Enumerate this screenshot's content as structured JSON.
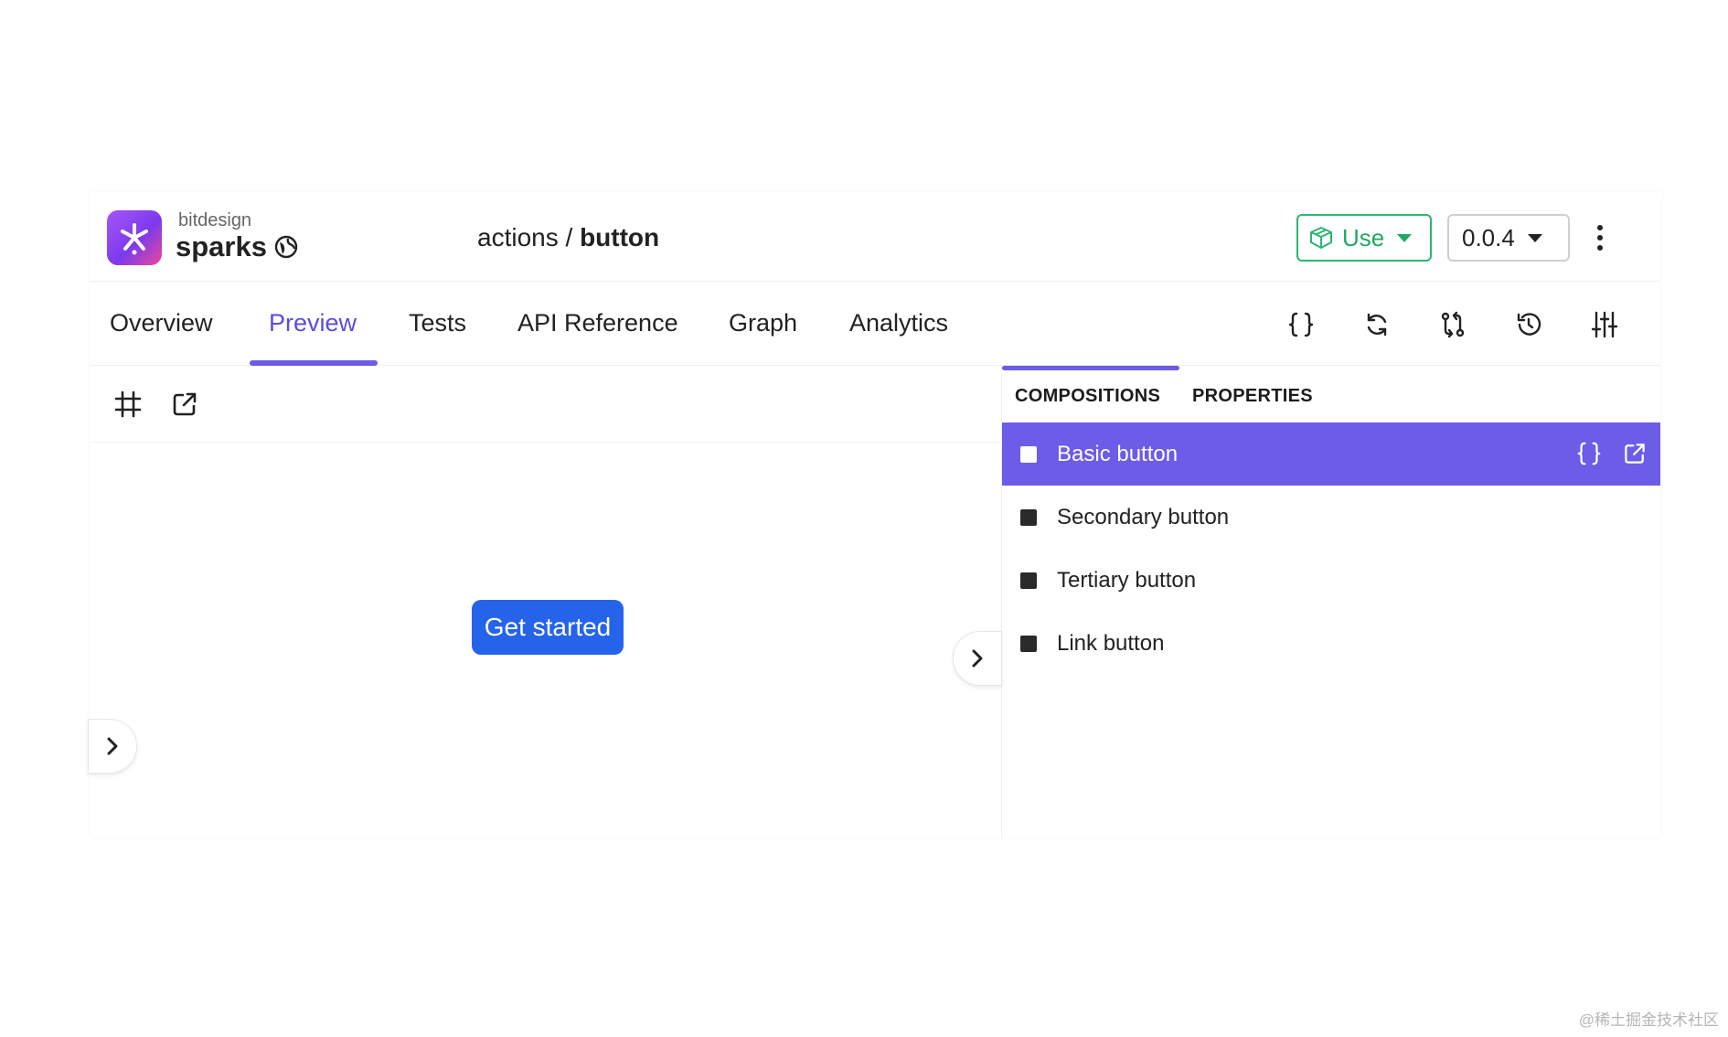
{
  "header": {
    "org": "bitdesign",
    "scope": "sparks",
    "breadcrumb_scope": "actions",
    "breadcrumb_sep": "/",
    "breadcrumb_name": "button",
    "use_label": "Use",
    "version": "0.0.4"
  },
  "tabs": [
    {
      "label": "Overview"
    },
    {
      "label": "Preview"
    },
    {
      "label": "Tests"
    },
    {
      "label": "API Reference"
    },
    {
      "label": "Graph"
    },
    {
      "label": "Analytics"
    }
  ],
  "active_tab": "Preview",
  "toolbar_icons": [
    "code-braces-icon",
    "refresh-icon",
    "compare-icon",
    "history-icon",
    "sliders-icon"
  ],
  "preview": {
    "button_label": "Get started"
  },
  "panel": {
    "tabs": [
      {
        "label": "COMPOSITIONS"
      },
      {
        "label": "PROPERTIES"
      }
    ],
    "items": [
      {
        "label": "Basic button"
      },
      {
        "label": "Secondary button"
      },
      {
        "label": "Tertiary button"
      },
      {
        "label": "Link button"
      }
    ],
    "active_item": "Basic button"
  },
  "colors": {
    "accent": "#6c5ce7",
    "use_green": "#2bb673",
    "preview_button": "#2563eb"
  },
  "watermark": "@稀土掘金技术社区"
}
